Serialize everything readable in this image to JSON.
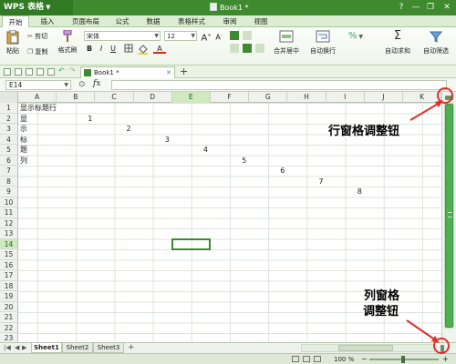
{
  "titlebar": {
    "app_name": "WPS 表格",
    "doc_title": "Book1 *",
    "win_buttons": [
      "?",
      "—",
      "❐",
      "✕"
    ],
    "win_icons": [
      "help-icon",
      "minimize-icon",
      "restore-icon",
      "close-icon"
    ]
  },
  "menu": {
    "tabs": [
      "开始",
      "插入",
      "页面布局",
      "公式",
      "数据",
      "表格样式",
      "审阅",
      "视图"
    ],
    "active_index": 0
  },
  "ribbon": {
    "paste_label": "粘贴",
    "cut_label": "剪切",
    "copy_label": "复制",
    "format_painter_label": "格式刷",
    "font_name": "宋体",
    "font_size": "12",
    "bold": "B",
    "italic": "I",
    "underline": "U",
    "font_color_letter": "A",
    "merge_center_label": "合并居中",
    "wrap_text_label": "自动换行",
    "percent_label": "%",
    "autosum_label": "自动求和",
    "autofilter_label": "自动筛选"
  },
  "doc_tab": {
    "label": "Book1 *"
  },
  "formula_bar": {
    "name_box": "E14",
    "fx_label": "fx",
    "formula_value": ""
  },
  "grid": {
    "columns": [
      "A",
      "B",
      "C",
      "D",
      "E",
      "F",
      "G",
      "H",
      "I",
      "J",
      "K"
    ],
    "rows": [
      "1",
      "2",
      "3",
      "4",
      "5",
      "6",
      "7",
      "8",
      "9",
      "10",
      "11",
      "12",
      "13",
      "14",
      "15",
      "16",
      "17",
      "18",
      "19",
      "20",
      "21",
      "22",
      "23"
    ],
    "selected_cell": "E14",
    "selected_column": "E",
    "selected_row": "14",
    "cells": [
      {
        "ref": "A1",
        "value": "显示标题行"
      },
      {
        "ref": "A2",
        "value": "显"
      },
      {
        "ref": "A3",
        "value": "示"
      },
      {
        "ref": "A4",
        "value": "标"
      },
      {
        "ref": "A5",
        "value": "题"
      },
      {
        "ref": "A6",
        "value": "列"
      },
      {
        "ref": "B2",
        "value": "1"
      },
      {
        "ref": "C3",
        "value": "2"
      },
      {
        "ref": "D4",
        "value": "3"
      },
      {
        "ref": "E5",
        "value": "4"
      },
      {
        "ref": "F6",
        "value": "5"
      },
      {
        "ref": "G7",
        "value": "6"
      },
      {
        "ref": "H8",
        "value": "7"
      },
      {
        "ref": "I9",
        "value": "8"
      }
    ]
  },
  "sheet_tabs": {
    "tabs": [
      "Sheet1",
      "Sheet2",
      "Sheet3"
    ],
    "active_index": 0,
    "add_label": "+"
  },
  "statusbar": {
    "zoom_text": "100 %",
    "zoom_minus": "−",
    "zoom_plus": "+"
  },
  "annotations": {
    "row_pane_label": "行窗格调整钮",
    "col_pane_label_line1": "列窗格",
    "col_pane_label_line2": "调整钮",
    "color": "#e0302a"
  },
  "colors": {
    "title_green": "#3f8a2f",
    "accent_green": "#4caf50",
    "selection_green": "#3c8a2f"
  }
}
